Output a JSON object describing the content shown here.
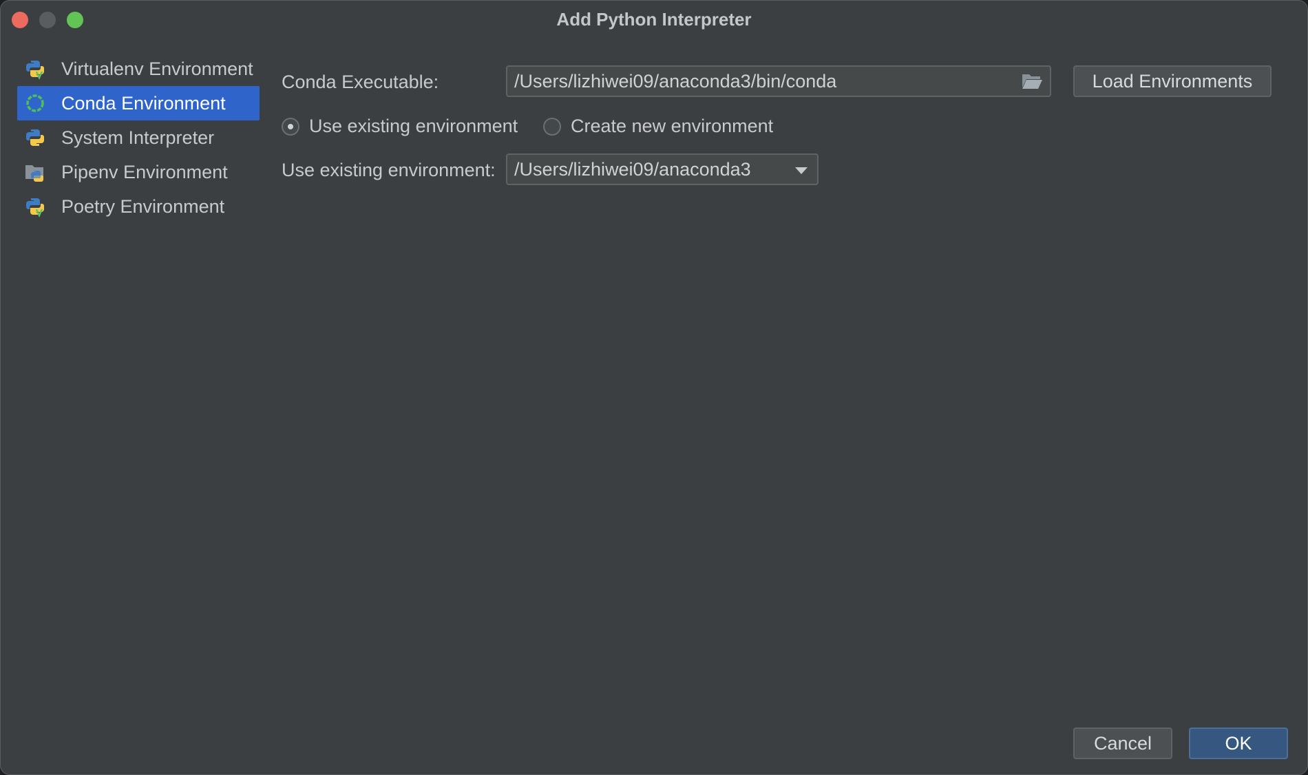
{
  "window": {
    "title": "Add Python Interpreter"
  },
  "sidebar": {
    "items": [
      {
        "label": "Virtualenv Environment",
        "icon": "python-virtualenv-icon",
        "selected": false
      },
      {
        "label": "Conda Environment",
        "icon": "conda-icon",
        "selected": true
      },
      {
        "label": "System Interpreter",
        "icon": "python-icon",
        "selected": false
      },
      {
        "label": "Pipenv Environment",
        "icon": "pipenv-icon",
        "selected": false
      },
      {
        "label": "Poetry Environment",
        "icon": "poetry-icon",
        "selected": false
      }
    ]
  },
  "conda": {
    "executable_label": "Conda Executable:",
    "executable_value": "/Users/lizhiwei09/anaconda3/bin/conda",
    "load_button": "Load Environments",
    "radio_existing": "Use existing environment",
    "radio_new": "Create new environment",
    "existing_label": "Use existing environment:",
    "existing_value": "/Users/lizhiwei09/anaconda3"
  },
  "footer": {
    "cancel": "Cancel",
    "ok": "OK"
  },
  "colors": {
    "background": "#3c3f41",
    "selection": "#2f65ca",
    "primary_button": "#365880",
    "close": "#ed6a5e",
    "maximize": "#61c454"
  }
}
